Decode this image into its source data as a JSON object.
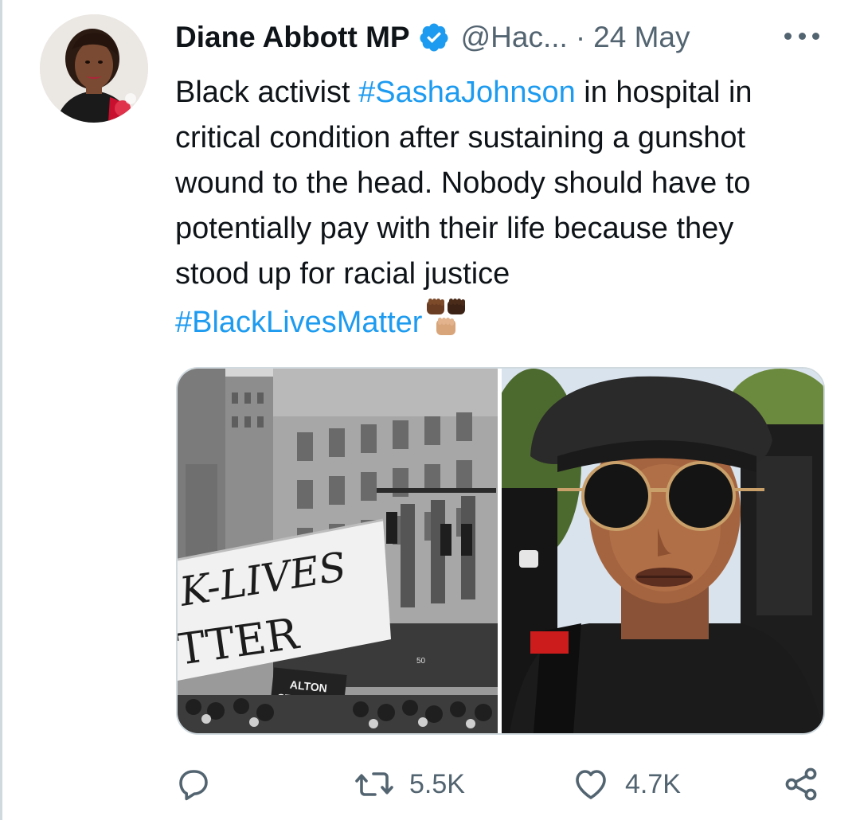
{
  "tweet": {
    "author_name": "Diane Abbott MP",
    "handle": "@Hac...",
    "separator": "·",
    "date": "24 May",
    "text_lines": [
      {
        "before": "Black activist ",
        "tag": "#SashaJohnson",
        "after": " in hospital in"
      },
      {
        "text": "critical condition after sustaining a gunshot"
      },
      {
        "text": "wound to the head. Nobody should have to"
      },
      {
        "text": "potentially pay with their life because they"
      },
      {
        "text": "stood up for racial justice"
      }
    ],
    "final_hashtag": "#BlackLivesMatter",
    "emoji": "raised-fists-emoji"
  },
  "media": {
    "left_photo": {
      "banner_line1": "K-LIVES",
      "banner_line2": "TTER",
      "sign_line1": "ALTON",
      "sign_line2": "STERLING",
      "street_number": "50"
    },
    "right_photo": {
      "description_icon": "portrait-photo"
    }
  },
  "actions": {
    "reply_icon": "reply-icon",
    "retweet_count": "5.5K",
    "like_count": "4.7K",
    "share_icon": "share-icon"
  },
  "colors": {
    "accent": "#1d9bf0",
    "text": "#0f1419",
    "secondary": "#536471",
    "border": "#cfd9de"
  }
}
